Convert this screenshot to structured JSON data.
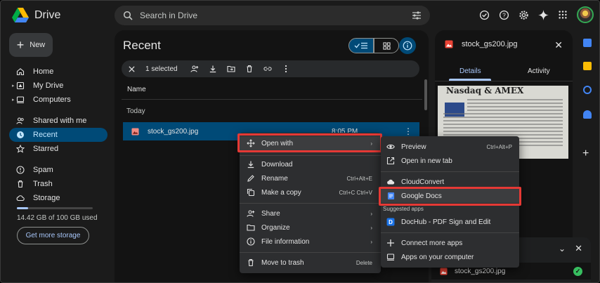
{
  "app": {
    "name": "Drive"
  },
  "search": {
    "placeholder": "Search in Drive"
  },
  "sidebar": {
    "new_label": "New",
    "items": [
      {
        "label": "Home",
        "icon": "home-icon"
      },
      {
        "label": "My Drive",
        "icon": "drive-icon"
      },
      {
        "label": "Computers",
        "icon": "computer-icon"
      },
      {
        "label": "Shared with me",
        "icon": "people-icon"
      },
      {
        "label": "Recent",
        "icon": "clock-icon",
        "active": true
      },
      {
        "label": "Starred",
        "icon": "star-icon"
      },
      {
        "label": "Spam",
        "icon": "spam-icon"
      },
      {
        "label": "Trash",
        "icon": "trash-icon"
      },
      {
        "label": "Storage",
        "icon": "cloud-icon"
      }
    ],
    "storage_text": "14.42 GB of 100 GB used",
    "storage_fraction": 0.1442,
    "get_more_storage": "Get more storage"
  },
  "main": {
    "title": "Recent",
    "selection_count": "1 selected",
    "column_name": "Name",
    "section_today": "Today",
    "file": {
      "name": "stock_gs200.jpg",
      "time": "8:05 PM"
    }
  },
  "details": {
    "title": "stock_gs200.jpg",
    "tabs": [
      "Details",
      "Activity"
    ],
    "thumbnail_headline": "Nasdaq & AMEX"
  },
  "context_menu": {
    "items": [
      {
        "label": "Open with",
        "icon": "move-icon",
        "arrow": "›"
      },
      {
        "label": "Download",
        "icon": "download-icon"
      },
      {
        "label": "Rename",
        "icon": "rename-icon",
        "shortcut": "Ctrl+Alt+E"
      },
      {
        "label": "Make a copy",
        "icon": "copy-icon",
        "shortcut": "Ctrl+C Ctrl+V"
      },
      {
        "label": "Share",
        "icon": "share-icon",
        "arrow": "›"
      },
      {
        "label": "Organize",
        "icon": "organize-icon",
        "arrow": "›"
      },
      {
        "label": "File information",
        "icon": "info-icon",
        "arrow": "›"
      },
      {
        "label": "Move to trash",
        "icon": "trash-icon",
        "shortcut": "Delete"
      }
    ]
  },
  "open_with_menu": {
    "preview": {
      "label": "Preview",
      "shortcut": "Ctrl+Alt+P"
    },
    "new_tab": {
      "label": "Open in new tab"
    },
    "cloudconvert": {
      "label": "CloudConvert"
    },
    "google_docs": {
      "label": "Google Docs"
    },
    "suggested_heading": "Suggested apps",
    "dochub": {
      "label": "DocHub - PDF Sign and Edit"
    },
    "connect_more": {
      "label": "Connect more apps"
    },
    "apps_on_computer": {
      "label": "Apps on your computer"
    }
  },
  "upload_panel": {
    "file_name": "stock_gs200.jpg"
  },
  "colors": {
    "accent": "#a8c7fa",
    "selected_row": "#004a77",
    "highlight_box": "#e53935",
    "success": "#37be5f"
  }
}
